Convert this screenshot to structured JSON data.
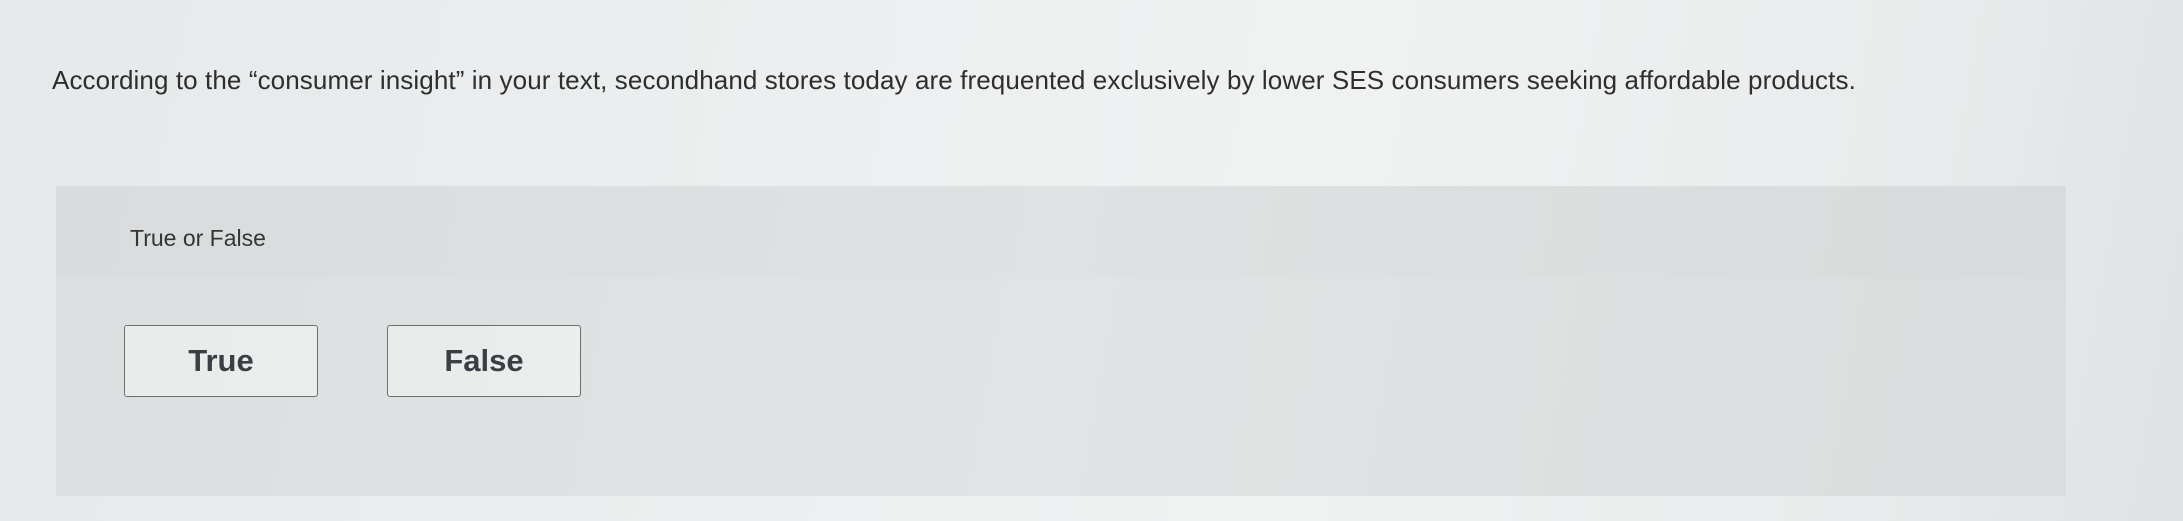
{
  "question": {
    "text": "According to the “consumer insight” in your text, secondhand stores today are frequented exclusively by lower SES consumers seeking affordable products.",
    "type_label": "True or False"
  },
  "choices": [
    {
      "label": "True"
    },
    {
      "label": "False"
    }
  ]
}
